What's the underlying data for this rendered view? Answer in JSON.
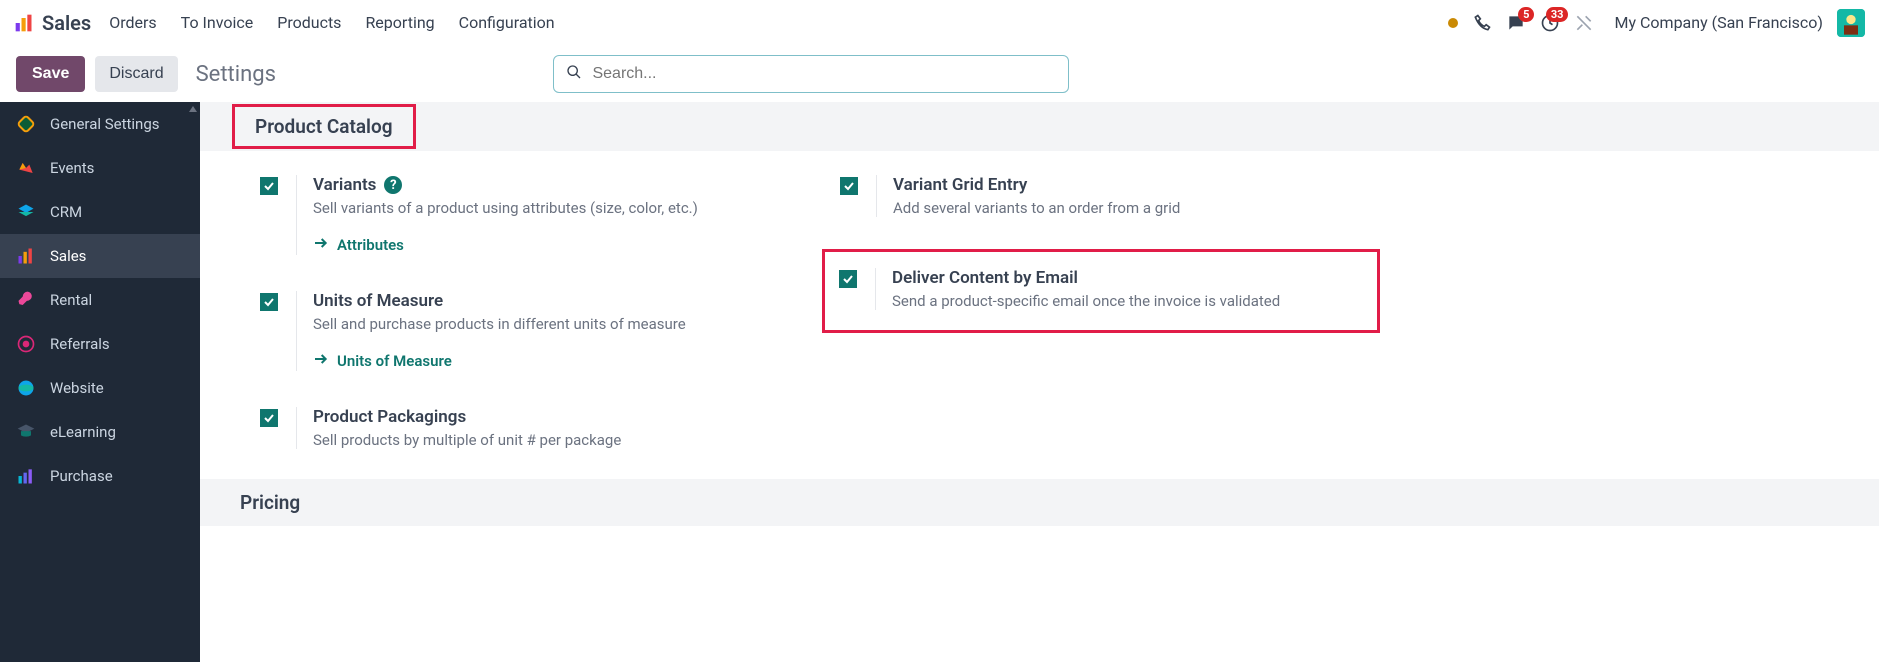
{
  "nav": {
    "app": "Sales",
    "links": [
      "Orders",
      "To Invoice",
      "Products",
      "Reporting",
      "Configuration"
    ]
  },
  "header_right": {
    "messages_badge": "5",
    "activities_badge": "33",
    "company": "My Company (San Francisco)"
  },
  "actionbar": {
    "save": "Save",
    "discard": "Discard",
    "title": "Settings",
    "search_placeholder": "Search..."
  },
  "sidebar": {
    "items": [
      {
        "label": "General Settings"
      },
      {
        "label": "Events"
      },
      {
        "label": "CRM"
      },
      {
        "label": "Sales"
      },
      {
        "label": "Rental"
      },
      {
        "label": "Referrals"
      },
      {
        "label": "Website"
      },
      {
        "label": "eLearning"
      },
      {
        "label": "Purchase"
      }
    ]
  },
  "sections": {
    "product_catalog": {
      "title": "Product Catalog",
      "left": [
        {
          "title": "Variants",
          "desc": "Sell variants of a product using attributes (size, color, etc.)",
          "link": "Attributes",
          "help": true
        },
        {
          "title": "Units of Measure",
          "desc": "Sell and purchase products in different units of measure",
          "link": "Units of Measure"
        },
        {
          "title": "Product Packagings",
          "desc": "Sell products by multiple of unit # per package"
        }
      ],
      "right": [
        {
          "title": "Variant Grid Entry",
          "desc": "Add several variants to an order from a grid"
        },
        {
          "title": "Deliver Content by Email",
          "desc": "Send a product-specific email once the invoice is validated"
        }
      ]
    },
    "pricing": {
      "title": "Pricing"
    }
  }
}
